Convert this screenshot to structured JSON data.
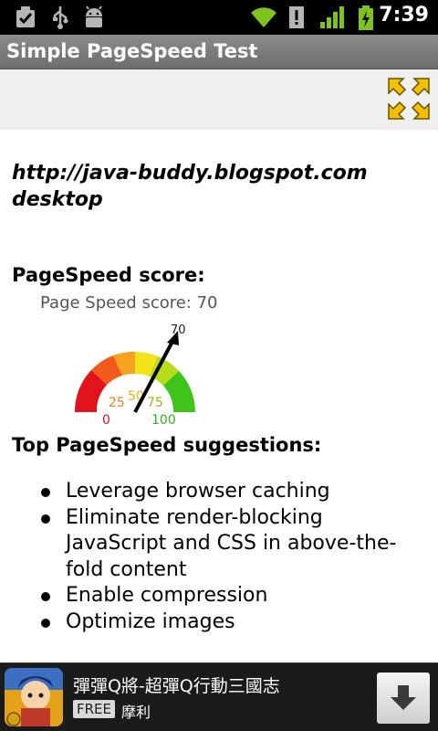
{
  "status_bar": {
    "time": "7:39",
    "icons": [
      "checkbox-notification-icon",
      "usb-icon",
      "android-debug-icon",
      "wifi-icon",
      "alert-icon",
      "signal-icon",
      "battery-charging-icon"
    ]
  },
  "app": {
    "title": "Simple PageSpeed Test"
  },
  "result": {
    "url": "http://java-buddy.blogspot.com",
    "strategy": "desktop",
    "score_label": "PageSpeed score:",
    "gauge": {
      "title": "Page Speed score: 70",
      "score": 70,
      "ticks": [
        "0",
        "25",
        "50",
        "75",
        "100"
      ],
      "needle_label": "70"
    },
    "suggestions_label": "Top PageSpeed suggestions:",
    "suggestions": [
      "Leverage browser caching",
      "Eliminate render-blocking JavaScript and CSS in above-the-fold content",
      "Enable compression",
      "Optimize images"
    ]
  },
  "ad": {
    "title": "彈彈Q將-超彈Q行動三國志",
    "free_label": "FREE",
    "publisher": "摩利",
    "icon": "game-character-icon",
    "download_icon": "download-arrow-icon"
  },
  "colors": {
    "status_bar": "#000000",
    "title_bar": "#7d7d7d",
    "toolbar": "#efefef",
    "expand_icon": "#f2c200",
    "ad_background": "#1b1b1b"
  }
}
